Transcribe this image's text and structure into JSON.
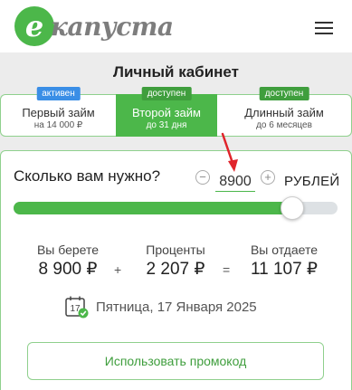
{
  "header": {
    "logo_letter": "e",
    "logo_text": "капуста",
    "brand_color": "#4cb74a",
    "menu_icon": "hamburger-menu-icon"
  },
  "cabinet": {
    "title": "Личный кабинет"
  },
  "tabs": [
    {
      "badge": "активен",
      "name": "Первый займ",
      "sub": "на 14 000 ₽",
      "badge_color": "#3a8ee6",
      "selected": false
    },
    {
      "badge": "доступен",
      "name": "Второй займ",
      "sub": "до 31 дня",
      "badge_color": "#3f9e3d",
      "selected": true
    },
    {
      "badge": "доступен",
      "name": "Длинный займ",
      "sub": "до 6 месяцев",
      "badge_color": "#3f9e3d",
      "selected": false
    }
  ],
  "calculator": {
    "question": "Сколько вам нужно?",
    "minus": "−",
    "plus": "+",
    "amount": "8900",
    "currency": "РУБЛЕЙ",
    "slider_fraction": 0.86
  },
  "summary": {
    "take_label": "Вы берете",
    "take_value": "8 900 ₽",
    "plus_sign": "+",
    "interest_label": "Проценты",
    "interest_value": "2 207 ₽",
    "equals_sign": "=",
    "return_label": "Вы отдаете",
    "return_value": "11 107 ₽"
  },
  "date": {
    "calendar_day": "17",
    "text": "Пятница, 17 Января 2025"
  },
  "promo": {
    "label": "Использовать промокод"
  }
}
